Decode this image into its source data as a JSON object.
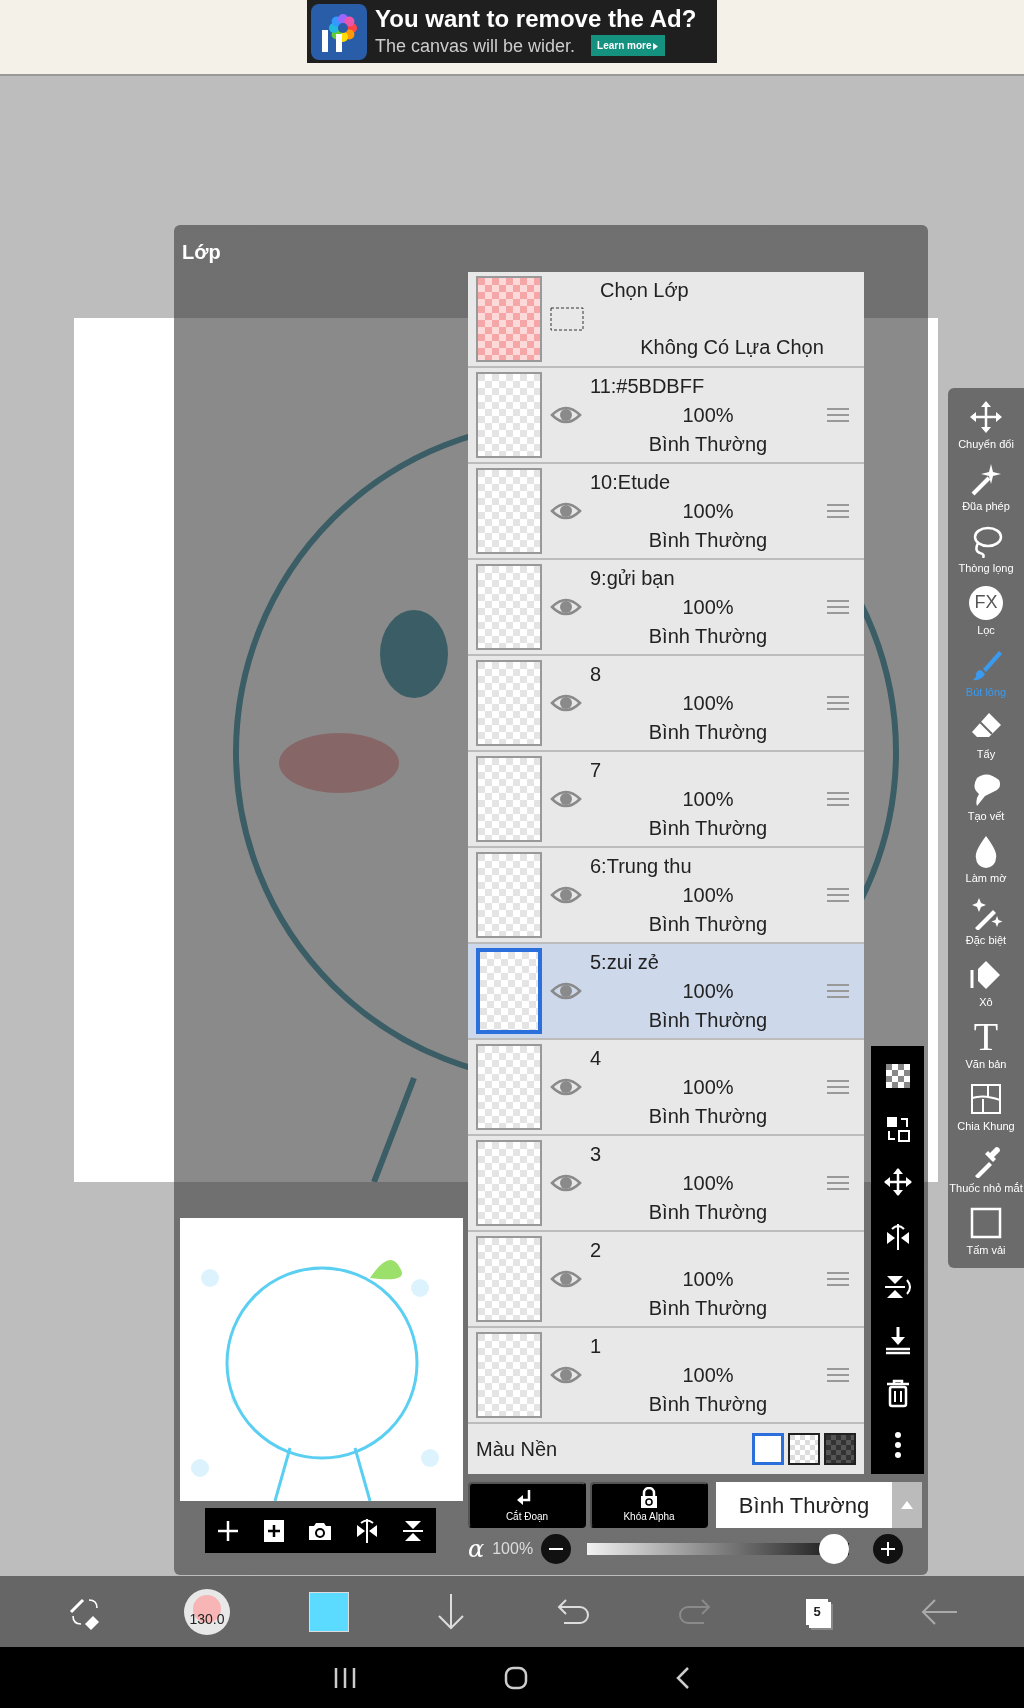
{
  "ad": {
    "title": "You want to remove the Ad?",
    "subtitle": "The canvas will be wider.",
    "button": "Learn more"
  },
  "panel": {
    "title": "Lớp"
  },
  "selection": {
    "title": "Chọn Lớp",
    "status": "Không Có Lựa Chọn"
  },
  "layers": [
    {
      "name": "11:#5BDBFF",
      "opacity": "100%",
      "blend": "Bình Thường",
      "visible": true,
      "selected": false
    },
    {
      "name": "10:Etude",
      "opacity": "100%",
      "blend": "Bình Thường",
      "visible": true,
      "selected": false
    },
    {
      "name": "9:gửi bạn",
      "opacity": "100%",
      "blend": "Bình Thường",
      "visible": true,
      "selected": false
    },
    {
      "name": "8",
      "opacity": "100%",
      "blend": "Bình Thường",
      "visible": true,
      "selected": false
    },
    {
      "name": "7",
      "opacity": "100%",
      "blend": "Bình Thường",
      "visible": true,
      "selected": false
    },
    {
      "name": "6:Trung thu",
      "opacity": "100%",
      "blend": "Bình Thường",
      "visible": true,
      "selected": false
    },
    {
      "name": "5:zui zẻ",
      "opacity": "100%",
      "blend": "Bình Thường",
      "visible": true,
      "selected": true
    },
    {
      "name": "4",
      "opacity": "100%",
      "blend": "Bình Thường",
      "visible": true,
      "selected": false
    },
    {
      "name": "3",
      "opacity": "100%",
      "blend": "Bình Thường",
      "visible": true,
      "selected": false
    },
    {
      "name": "2",
      "opacity": "100%",
      "blend": "Bình Thường",
      "visible": true,
      "selected": false
    },
    {
      "name": "1",
      "opacity": "100%",
      "blend": "Bình Thường",
      "visible": true,
      "selected": false
    }
  ],
  "background": {
    "label": "Màu Nền",
    "options": [
      {
        "kind": "white",
        "selected": true
      },
      {
        "kind": "transparent",
        "selected": false
      },
      {
        "kind": "dark",
        "selected": false
      }
    ]
  },
  "actions": [
    {
      "label": "Cắt Đoạn"
    },
    {
      "label": "Khóa Alpha"
    }
  ],
  "blend_mode": {
    "value": "Bình Thường"
  },
  "alpha": {
    "symbol": "α",
    "reading": "100%",
    "level": 1
  },
  "tools": [
    {
      "label": "Chuyển đổi",
      "selected": false
    },
    {
      "label": "Đũa phép",
      "selected": false
    },
    {
      "label": "Thòng lọng",
      "selected": false
    },
    {
      "label": "Lọc",
      "glyph": "FX",
      "selected": false
    },
    {
      "label": "Bút lông",
      "selected": true
    },
    {
      "label": "Tẩy",
      "selected": false
    },
    {
      "label": "Tạo vết",
      "selected": false
    },
    {
      "label": "Làm mờ",
      "selected": false
    },
    {
      "label": "Đặc biệt",
      "selected": false
    },
    {
      "label": "Xô",
      "selected": false
    },
    {
      "label": "Văn bản",
      "glyph": "T",
      "selected": false
    },
    {
      "label": "Chia Khung",
      "selected": false
    },
    {
      "label": "Thuốc nhỏ mắt",
      "selected": false
    },
    {
      "label": "Tấm vải",
      "selected": false
    }
  ],
  "bottom_bar": {
    "brush_size": "130.0",
    "color": "#5bdbff",
    "layer_count": "5"
  }
}
